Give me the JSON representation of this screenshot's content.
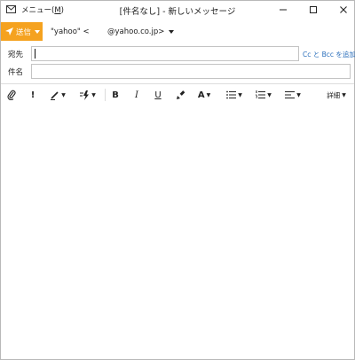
{
  "window": {
    "menu_label": "メニュー(",
    "menu_key": "M",
    "menu_close": ")",
    "title": "[件名なし] - 新しいメッセージ"
  },
  "compose": {
    "send_label": "送信",
    "from_name": "\"yahoo\" <",
    "from_domain": "@yahoo.co.jp>",
    "to_label": "宛先",
    "to_value": "",
    "cc_bcc_link": "Cc と Bcc を追加",
    "subject_label": "件名",
    "subject_value": ""
  },
  "toolbar": {
    "priority_label": "!",
    "bold_label": "B",
    "italic_label": "I",
    "underline_label": "U",
    "font_color_label": "A",
    "details_label": "詳細"
  },
  "colors": {
    "send_button": "#f5a21f",
    "link": "#2a6ebb"
  },
  "icons": {
    "app": "envelope-icon",
    "attach": "paperclip-icon",
    "style": "pen-icon",
    "quick": "lightning-icon",
    "format_painter": "brush-icon",
    "bullets": "bullet-list-icon",
    "numbering": "numbered-list-icon",
    "align": "align-icon"
  }
}
